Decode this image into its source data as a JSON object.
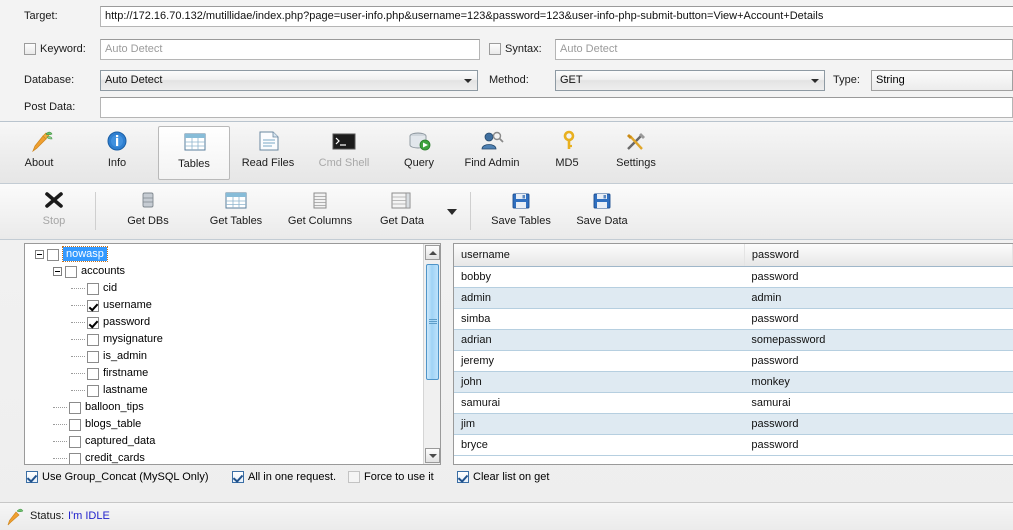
{
  "params": {
    "target_label": "Target:",
    "target_value": "http://172.16.70.132/mutillidae/index.php?page=user-info.php&username=123&password=123&user-info-php-submit-button=View+Account+Details",
    "keyword_label": "Keyword:",
    "keyword_placeholder": "Auto Detect",
    "keyword_checked": false,
    "syntax_label": "Syntax:",
    "syntax_placeholder": "Auto Detect",
    "syntax_checked": false,
    "database_label": "Database:",
    "database_value": "Auto Detect",
    "method_label": "Method:",
    "method_value": "GET",
    "type_label": "Type:",
    "type_value": "String",
    "postdata_label": "Post Data:",
    "postdata_value": ""
  },
  "toolbar_main": [
    {
      "label": "About",
      "icon": "carrot-icon",
      "state": "normal"
    },
    {
      "label": "Info",
      "icon": "info-icon",
      "state": "normal"
    },
    {
      "label": "Tables",
      "icon": "table-grid-icon",
      "state": "selected"
    },
    {
      "label": "Read Files",
      "icon": "document-icon",
      "state": "normal"
    },
    {
      "label": "Cmd Shell",
      "icon": "console-icon",
      "state": "disabled"
    },
    {
      "label": "Query",
      "icon": "database-query-icon",
      "state": "normal"
    },
    {
      "label": "Find Admin",
      "icon": "find-admin-icon",
      "state": "normal"
    },
    {
      "label": "MD5",
      "icon": "key-icon",
      "state": "normal"
    },
    {
      "label": "Settings",
      "icon": "tools-icon",
      "state": "normal"
    }
  ],
  "toolbar_actions": [
    {
      "label": "Stop",
      "icon": "stop-x-icon",
      "state": "disabled"
    },
    {
      "label": "Get DBs",
      "icon": "db-cylinder-icon",
      "state": "normal"
    },
    {
      "label": "Get Tables",
      "icon": "table-grid-icon",
      "state": "normal"
    },
    {
      "label": "Get Columns",
      "icon": "columns-icon",
      "state": "normal"
    },
    {
      "label": "Get Data",
      "icon": "data-rows-icon",
      "state": "normal"
    },
    {
      "label": "Save Tables",
      "icon": "floppy-save-icon",
      "state": "normal"
    },
    {
      "label": "Save Data",
      "icon": "floppy-save-icon",
      "state": "normal"
    }
  ],
  "tree": {
    "nodes": [
      {
        "label": "nowasp",
        "depth": 0,
        "checked": false,
        "expander": "minus",
        "selected": true
      },
      {
        "label": "accounts",
        "depth": 1,
        "checked": false,
        "expander": "minus",
        "selected": false
      },
      {
        "label": "cid",
        "depth": 2,
        "checked": false,
        "expander": "none",
        "selected": false
      },
      {
        "label": "username",
        "depth": 2,
        "checked": true,
        "expander": "none",
        "selected": false
      },
      {
        "label": "password",
        "depth": 2,
        "checked": true,
        "expander": "none",
        "selected": false
      },
      {
        "label": "mysignature",
        "depth": 2,
        "checked": false,
        "expander": "none",
        "selected": false
      },
      {
        "label": "is_admin",
        "depth": 2,
        "checked": false,
        "expander": "none",
        "selected": false
      },
      {
        "label": "firstname",
        "depth": 2,
        "checked": false,
        "expander": "none",
        "selected": false
      },
      {
        "label": "lastname",
        "depth": 2,
        "checked": false,
        "expander": "none",
        "selected": false
      },
      {
        "label": "balloon_tips",
        "depth": 1,
        "checked": false,
        "expander": "none",
        "selected": false
      },
      {
        "label": "blogs_table",
        "depth": 1,
        "checked": false,
        "expander": "none",
        "selected": false
      },
      {
        "label": "captured_data",
        "depth": 1,
        "checked": false,
        "expander": "none",
        "selected": false
      },
      {
        "label": "credit_cards",
        "depth": 1,
        "checked": false,
        "expander": "none",
        "selected": false
      }
    ]
  },
  "grid": {
    "columns": [
      "username",
      "password"
    ],
    "rows": [
      [
        "bobby",
        "password"
      ],
      [
        "admin",
        "admin"
      ],
      [
        "simba",
        "password"
      ],
      [
        "adrian",
        "somepassword"
      ],
      [
        "jeremy",
        "password"
      ],
      [
        "john",
        "monkey"
      ],
      [
        "samurai",
        "samurai"
      ],
      [
        "jim",
        "password"
      ],
      [
        "bryce",
        "password"
      ]
    ]
  },
  "options": {
    "group_concat": {
      "label": "Use Group_Concat (MySQL Only)",
      "checked": true
    },
    "all_in_one": {
      "label": "All in one request.",
      "checked": true
    },
    "force_to_use": {
      "label": "Force to use it",
      "checked": false
    },
    "clear_list": {
      "label": "Clear list on get",
      "checked": true
    }
  },
  "status": {
    "label": "Status:",
    "value": "I'm IDLE"
  },
  "colors": {
    "accent": "#3399ff",
    "status_text": "#2222cc",
    "row_alt": "#dfeaf2",
    "grid_line": "#b6cfe0"
  }
}
